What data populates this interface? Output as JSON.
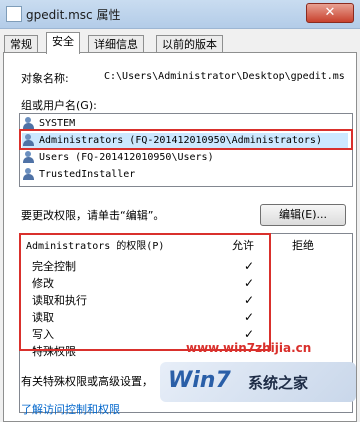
{
  "window": {
    "title": "gpedit.msc 属性",
    "close_label": "✕"
  },
  "tabs": [
    {
      "label": "常规",
      "active": false
    },
    {
      "label": "安全",
      "active": true
    },
    {
      "label": "详细信息",
      "active": false
    },
    {
      "label": "以前的版本",
      "active": false
    }
  ],
  "object": {
    "label": "对象名称:",
    "value": "C:\\Users\\Administrator\\Desktop\\gpedit.ms"
  },
  "groups": {
    "label": "组或用户名(G):",
    "items": [
      "SYSTEM",
      "Administrators (FQ-201412010950\\Administrators)",
      "Users (FQ-201412010950\\Users)",
      "TrustedInstaller"
    ],
    "selected_index": 1
  },
  "edit": {
    "hint": "要更改权限，请单击“编辑”。",
    "button_label": "编辑(E)..."
  },
  "permissions": {
    "header": "Administrators 的权限(P)",
    "allow_label": "允许",
    "deny_label": "拒绝",
    "rows": [
      {
        "name": "完全控制",
        "allow": "✓"
      },
      {
        "name": "修改",
        "allow": "✓"
      },
      {
        "name": "读取和执行",
        "allow": "✓"
      },
      {
        "name": "读取",
        "allow": "✓"
      },
      {
        "name": "写入",
        "allow": "✓"
      },
      {
        "name": "特殊权限",
        "allow": ""
      }
    ]
  },
  "footer": {
    "special_text": "有关特殊权限或高级设置，",
    "link_text": "了解访问控制和权限"
  },
  "watermark": {
    "url": "www.win7zhijia.cn",
    "logo_win": "Win7",
    "logo_site": "系统之家"
  },
  "colors": {
    "highlight_border": "#d9302c",
    "selection": "#cce8ff"
  }
}
